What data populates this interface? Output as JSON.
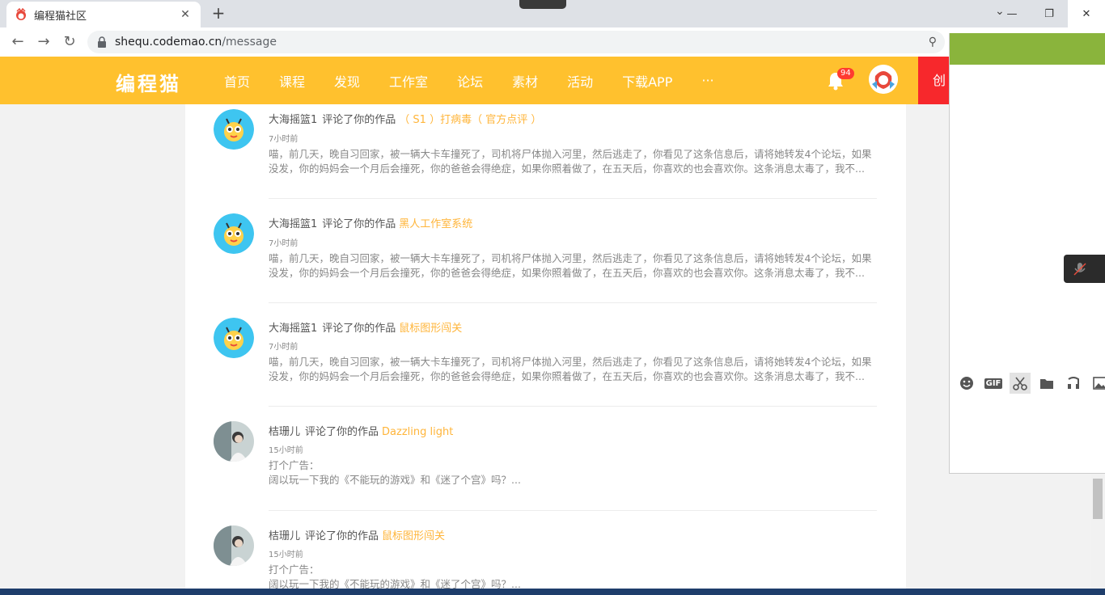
{
  "browser": {
    "tab_title": "编程猫社区",
    "url_host": "shequ.codemao.cn",
    "url_path": "/message"
  },
  "site": {
    "logo": "编程猫",
    "menu": [
      "首页",
      "课程",
      "发现",
      "工作室",
      "论坛",
      "素材",
      "活动",
      "下载APP",
      "···"
    ],
    "notification_count": "94",
    "create_label": "创"
  },
  "messages": [
    {
      "user": "大海摇篮1",
      "action": "评论了你的作品",
      "work": "（ S1 ）打病毒（ 官方点评 ）",
      "time": "7小时前",
      "body_line1": "喵，前几天，晚自习回家，被一辆大卡车撞死了，司机将尸体抛入河里，然后逃走了，你看见了这条信息后，请将她转发4个论坛，如果",
      "body_line2": "没发，你的妈妈会一个月后会撞死，你的爸爸会得绝症，如果你照着做了，在五天后，你喜欢的也会喜欢你。这条消息太毒了，我不..."
    },
    {
      "user": "大海摇篮1",
      "action": "评论了你的作品",
      "work": "黑人工作室系统",
      "time": "7小时前",
      "body_line1": "喵，前几天，晚自习回家，被一辆大卡车撞死了，司机将尸体抛入河里，然后逃走了，你看见了这条信息后，请将她转发4个论坛，如果",
      "body_line2": "没发，你的妈妈会一个月后会撞死，你的爸爸会得绝症，如果你照着做了，在五天后，你喜欢的也会喜欢你。这条消息太毒了，我不..."
    },
    {
      "user": "大海摇篮1",
      "action": "评论了你的作品",
      "work": "鼠标图形闯关",
      "time": "7小时前",
      "body_line1": "喵，前几天，晚自习回家，被一辆大卡车撞死了，司机将尸体抛入河里，然后逃走了，你看见了这条信息后，请将她转发4个论坛，如果",
      "body_line2": "没发，你的妈妈会一个月后会撞死，你的爸爸会得绝症，如果你照着做了，在五天后，你喜欢的也会喜欢你。这条消息太毒了，我不..."
    },
    {
      "user": "桔珊儿",
      "action": "评论了你的作品",
      "work": "Dazzling light",
      "time": "15小时前",
      "body_line1": "打个广告：",
      "body_line2": "阔以玩一下我的《不能玩的游戏》和《迷了个宫》吗？..."
    },
    {
      "user": "桔珊儿",
      "action": "评论了你的作品",
      "work": "鼠标图形闯关",
      "time": "15小时前",
      "body_line1": "打个广告：",
      "body_line2": "阔以玩一下我的《不能玩的游戏》和《迷了个宫》吗？..."
    }
  ],
  "chat": {
    "tools": [
      "emoji-icon",
      "gif-icon",
      "scissors-icon",
      "folder-icon",
      "music-icon",
      "image-icon"
    ],
    "gif_label": "GIF"
  },
  "colors": {
    "header": "#ffc12e",
    "accent_work": "#ffb53a",
    "create_button": "#f7282c",
    "chat_header": "#8ab43c"
  }
}
